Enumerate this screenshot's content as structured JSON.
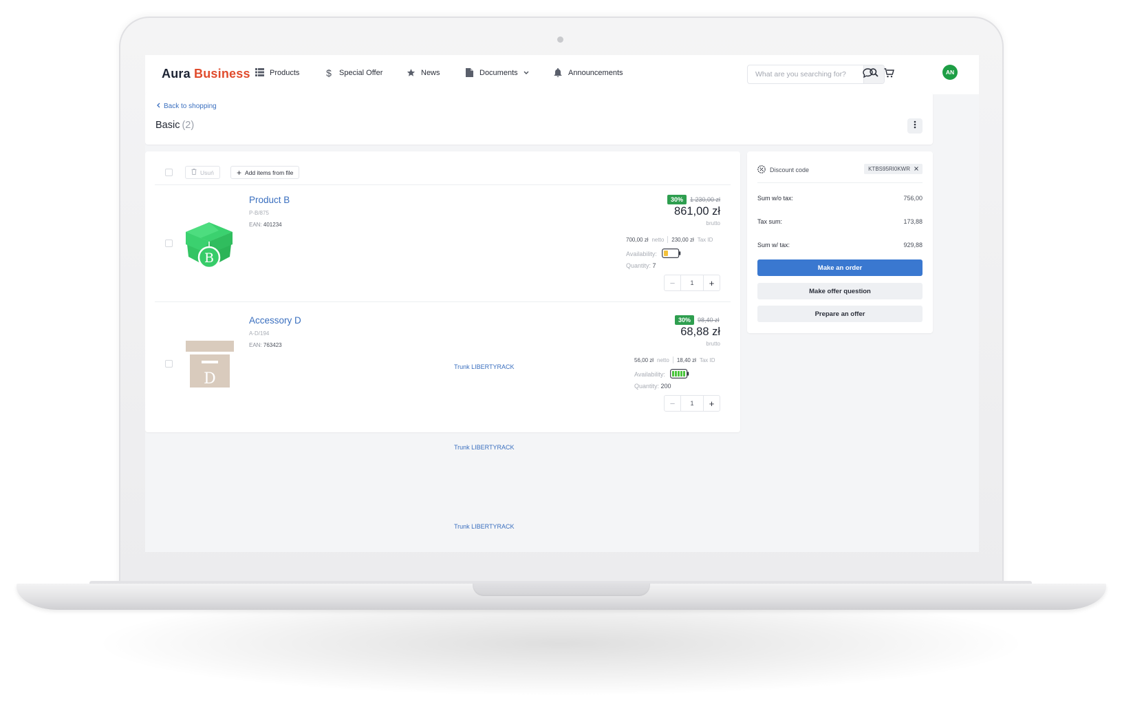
{
  "brand": {
    "part1": "Aura",
    "part2": "Business"
  },
  "nav": [
    {
      "label": "Products",
      "icon": "grid-list-icon"
    },
    {
      "label": "Special Offer",
      "icon": "dollar-icon"
    },
    {
      "label": "News",
      "icon": "star-icon"
    },
    {
      "label": "Documents",
      "icon": "document-icon"
    },
    {
      "label": "Announcements",
      "icon": "bell-icon"
    }
  ],
  "search": {
    "placeholder": "What are you searching for?"
  },
  "user": {
    "initials": "AN"
  },
  "header": {
    "back_label": "Back to shopping",
    "title": "Basic",
    "count": "(2)"
  },
  "toolbar": {
    "delete_label": "Usuń",
    "add_from_file_label": "Add items from file"
  },
  "items": [
    {
      "name": "Product B",
      "code": "P-B/875",
      "ean_label": "EAN:",
      "ean": "401234",
      "discount": "30%",
      "old_price": "1 230,00 zł",
      "price": "861,00 zł",
      "price_type": "brutto",
      "net": "700,00 zł",
      "net_label": "netto",
      "tax": "230,00 zł",
      "tax_label": "Tax ID",
      "availability_label": "Availability:",
      "availability_level": 0.3,
      "quantity_label": "Quantity:",
      "quantity": "7",
      "order_qty": "1",
      "image_letter": "B"
    },
    {
      "name": "Accessory D",
      "code": "A-D/194",
      "ean_label": "EAN:",
      "ean": "763423",
      "discount": "30%",
      "old_price": "98,40 zł",
      "price": "68,88 zł",
      "price_type": "brutto",
      "net": "56,00 zł",
      "net_label": "netto",
      "tax": "18,40 zł",
      "tax_label": "Tax ID",
      "availability_label": "Availability:",
      "availability_level": 1.0,
      "quantity_label": "Quantity:",
      "quantity": "200",
      "order_qty": "1",
      "image_letter": "D",
      "link": "Trunk LIBERTYRACK"
    }
  ],
  "extra_links": [
    "Trunk LIBERTYRACK",
    "Trunk LIBERTYRACK"
  ],
  "summary": {
    "discount_label": "Discount code",
    "discount_code": "KTBS95RI0KWR",
    "sum_wo_tax_label": "Sum w/o tax:",
    "sum_wo_tax": "756,00",
    "tax_sum_label": "Tax sum:",
    "tax_sum": "173,88",
    "sum_w_tax_label": "Sum w/ tax:",
    "sum_w_tax": "929,88",
    "order_button": "Make an order",
    "question_button": "Make offer question",
    "offer_button": "Prepare an offer"
  },
  "colors": {
    "brand_accent": "#e04b2c",
    "primary": "#3a78d0",
    "discount_badge": "#2e9e4f",
    "avatar": "#1e9e45"
  }
}
